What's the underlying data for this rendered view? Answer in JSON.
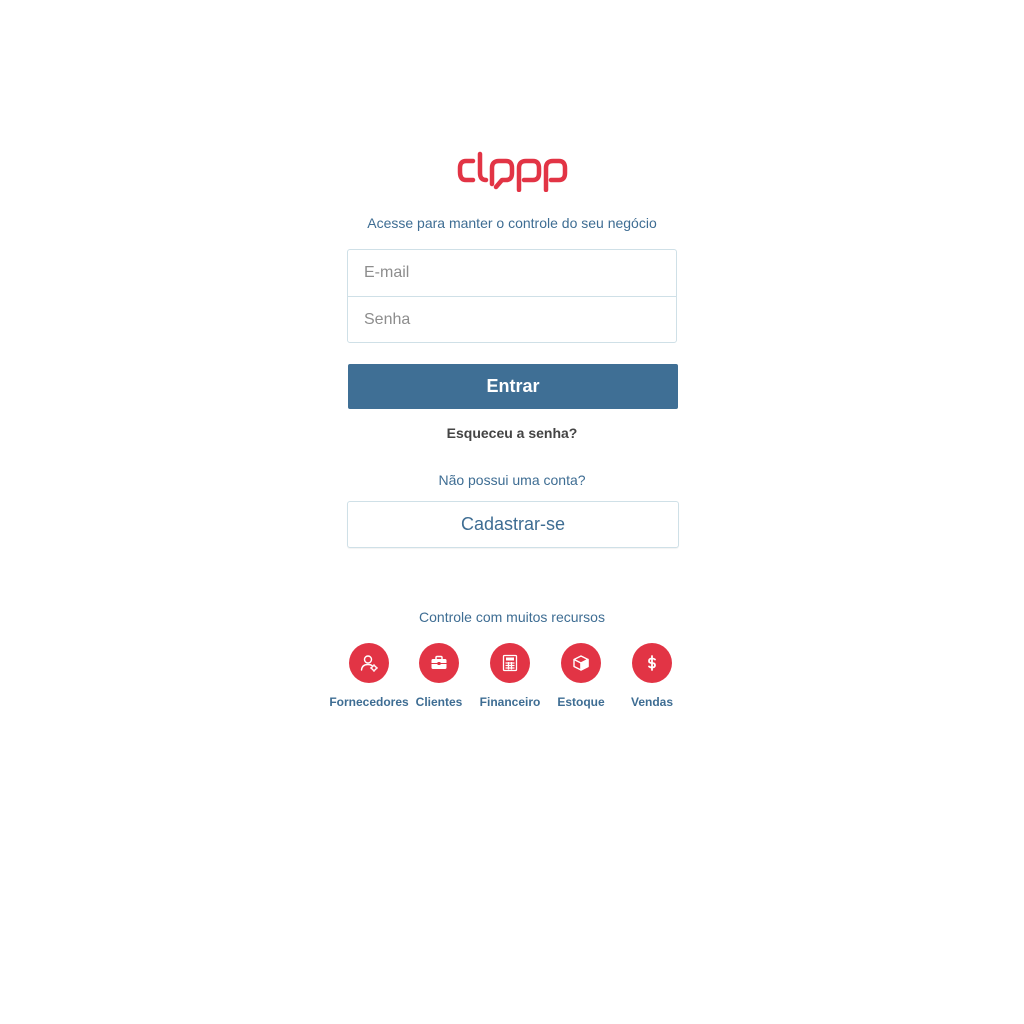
{
  "brand": {
    "logo_icon": "clipp-logo",
    "color": "#e23445"
  },
  "login": {
    "tagline": "Acesse para manter o controle do seu negócio",
    "email_placeholder": "E-mail",
    "password_placeholder": "Senha",
    "submit_label": "Entrar",
    "forgot_password": "Esqueceu a senha?"
  },
  "signup": {
    "prompt": "Não possui uma conta?",
    "button_label": "Cadastrar-se"
  },
  "features": {
    "title": "Controle com muitos recursos",
    "items": [
      {
        "label": "Fornecedores",
        "icon": "supplier-icon"
      },
      {
        "label": "Clientes",
        "icon": "briefcase-icon"
      },
      {
        "label": "Financeiro",
        "icon": "calculator-icon"
      },
      {
        "label": "Estoque",
        "icon": "box-icon"
      },
      {
        "label": "Vendas",
        "icon": "dollar-icon"
      }
    ]
  },
  "colors": {
    "primary": "#3f6f95",
    "text_blue": "#3e6d93",
    "accent_red": "#e23445",
    "border": "#cfe0e7"
  }
}
